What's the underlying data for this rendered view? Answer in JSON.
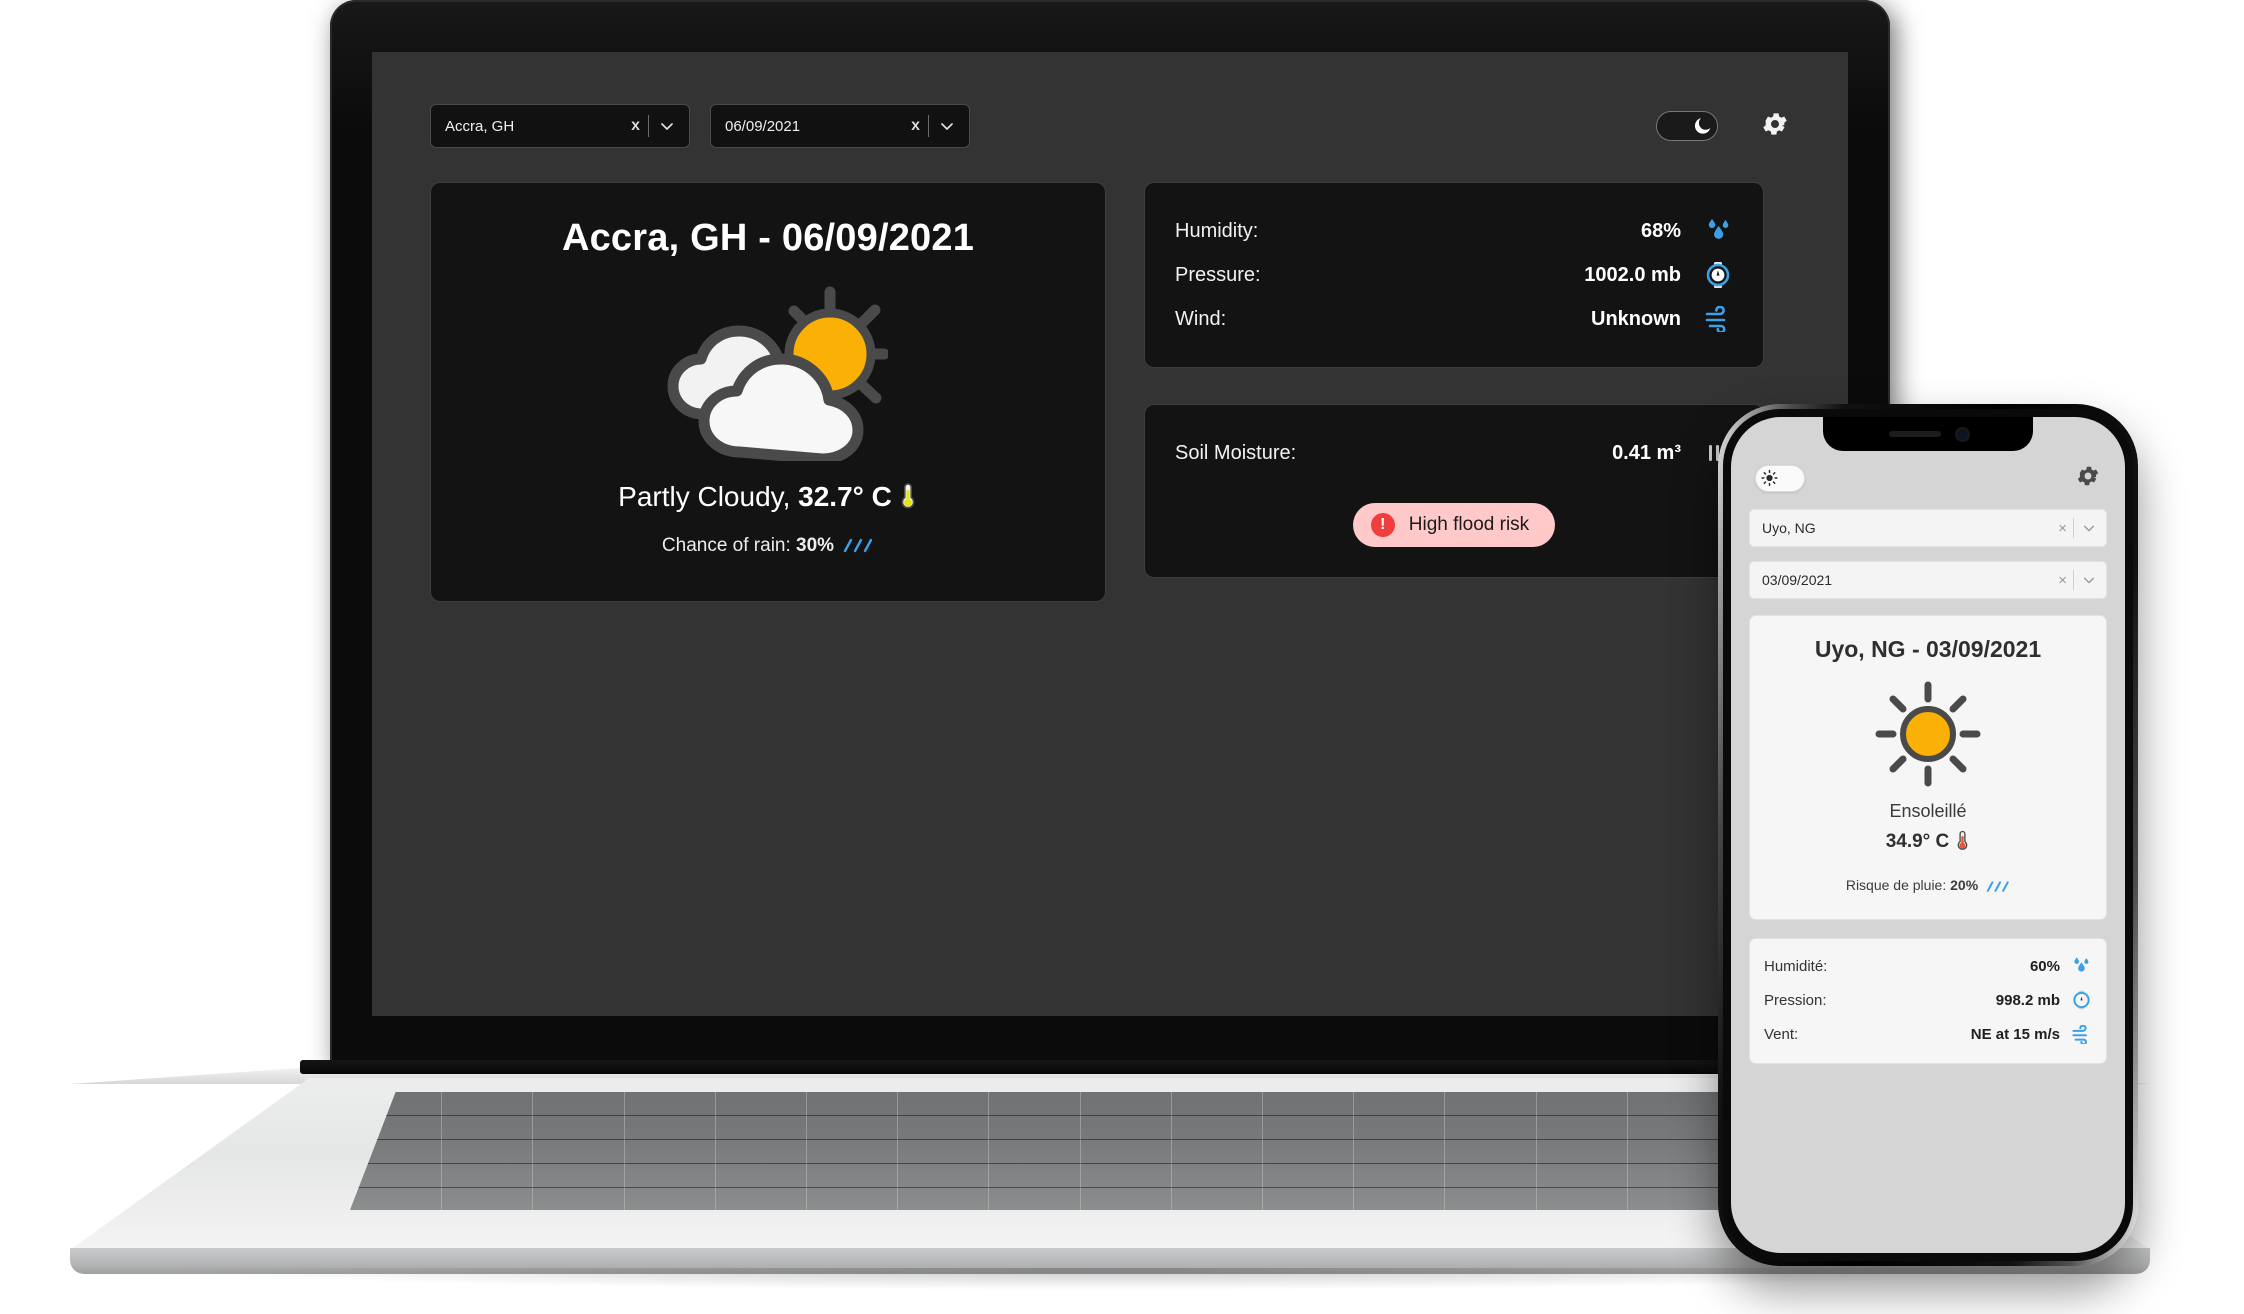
{
  "desktop": {
    "location_select": {
      "value": "Accra, GH",
      "clear_label": "x",
      "caret_icon": "chevron-down-icon"
    },
    "date_select": {
      "value": "06/09/2021",
      "clear_label": "x",
      "caret_icon": "chevron-down-icon"
    },
    "theme_toggle": {
      "state": "dark",
      "icon": "moon-icon"
    },
    "settings_icon": "gear-icon",
    "weather_card": {
      "title": "Accra, GH - 06/09/2021",
      "icon": "partly-cloudy-icon",
      "condition": "Partly Cloudy, ",
      "temperature": "32.7° C",
      "temperature_icon": "thermometer-icon",
      "rain_label": "Chance of rain: ",
      "rain_value": "30%",
      "rain_icon": "drizzle-icon"
    },
    "metrics": [
      {
        "label": "Humidity:",
        "value": "68%",
        "icon": "droplets-icon"
      },
      {
        "label": "Pressure:",
        "value": "1002.0 mb",
        "icon": "barometer-icon"
      },
      {
        "label": "Wind:",
        "value": "Unknown",
        "icon": "wind-icon"
      }
    ],
    "soil": {
      "label": "Soil Moisture:",
      "value": "0.41 m³",
      "icon": "soil-icon",
      "risk_badge": {
        "symbol": "!",
        "label": "High flood risk"
      }
    }
  },
  "phone": {
    "theme_toggle": {
      "state": "light",
      "icon": "sun-icon"
    },
    "settings_icon": "gear-icon",
    "location_select": {
      "value": "Uyo, NG",
      "clear_label": "×",
      "caret_icon": "chevron-down-icon"
    },
    "date_select": {
      "value": "03/09/2021",
      "clear_label": "×",
      "caret_icon": "chevron-down-icon"
    },
    "weather_card": {
      "title": "Uyo, NG - 03/09/2021",
      "icon": "sunny-icon",
      "condition": "Ensoleillé",
      "temperature": "34.9° C",
      "temperature_icon": "thermometer-icon",
      "rain_label": "Risque de pluie: ",
      "rain_value": "20%",
      "rain_icon": "drizzle-icon"
    },
    "metrics": [
      {
        "label": "Humidité:",
        "value": "60%",
        "icon": "droplets-icon"
      },
      {
        "label": "Pression:",
        "value": "998.2 mb",
        "icon": "barometer-icon"
      },
      {
        "label": "Vent:",
        "value": "NE at 15 m/s",
        "icon": "wind-icon"
      }
    ]
  },
  "colors": {
    "screen_bg": "#333333",
    "card_dark": "#131313",
    "accent_blue": "#3aa0e8",
    "sun_amber": "#fab005",
    "risk_bg": "#ffc9c9",
    "risk_red": "#f03e3e"
  }
}
